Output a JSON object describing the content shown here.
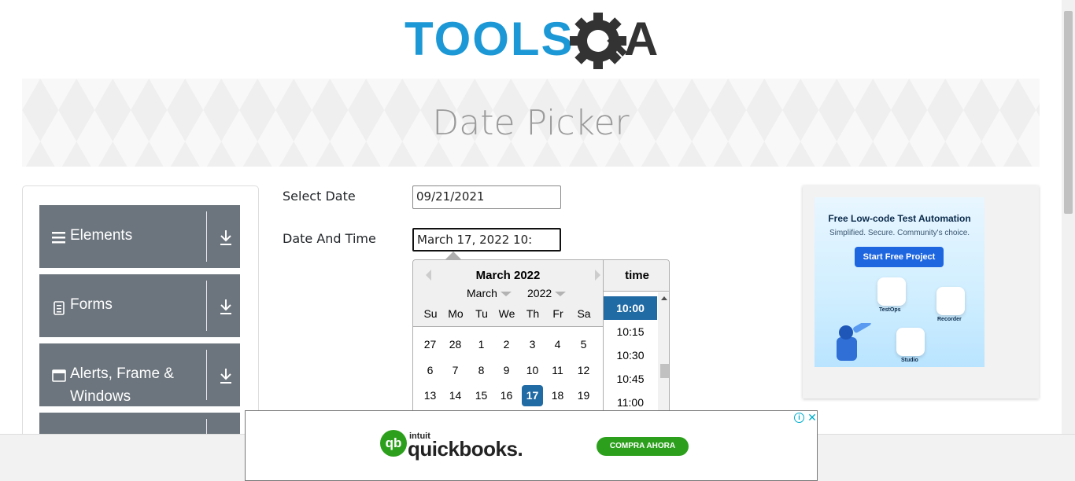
{
  "header": {
    "logo_text_left": "TOOLS",
    "logo_text_right": "A",
    "page_title": "Date Picker"
  },
  "sidebar": {
    "groups": [
      {
        "label": "Elements",
        "icon": "hamburger-icon"
      },
      {
        "label": "Forms",
        "icon": "document-icon"
      },
      {
        "label": "Alerts, Frame & Windows",
        "icon": "window-icon"
      }
    ],
    "group_toggle_icon": "download-arrow-icon"
  },
  "form": {
    "select_date_label": "Select Date",
    "select_date_value": "09/21/2021",
    "date_time_label": "Date And Time",
    "date_time_value": "March 17, 2022 10:"
  },
  "datepicker": {
    "month_title": "March 2022",
    "month_select": "March",
    "year_select": "2022",
    "weekdays": [
      "Su",
      "Mo",
      "Tu",
      "We",
      "Th",
      "Fr",
      "Sa"
    ],
    "weeks": [
      [
        "27",
        "28",
        "1",
        "2",
        "3",
        "4",
        "5"
      ],
      [
        "6",
        "7",
        "8",
        "9",
        "10",
        "11",
        "12"
      ],
      [
        "13",
        "14",
        "15",
        "16",
        "17",
        "18",
        "19"
      ]
    ],
    "selected_day": "17",
    "time_header": "time",
    "times": [
      "10:00",
      "10:15",
      "10:30",
      "10:45",
      "11:00"
    ],
    "selected_time": "10:00"
  },
  "ad_right": {
    "title": "Free Low-code Test Automation",
    "subtitle": "Simplified. Secure. Community's choice.",
    "button": "Start Free Project",
    "products": [
      "TestOps",
      "Recorder",
      "Studio"
    ]
  },
  "ad_bottom": {
    "brand_small": "intuit",
    "brand": "quickbooks.",
    "logo_glyph": "qb",
    "cta": "COMPRA AHORA",
    "info_glyph": "i",
    "close_glyph": "✕"
  },
  "colors": {
    "logo_blue": "#1b98d5",
    "logo_dark": "#333333",
    "sidebar_group": "#6c757d",
    "picker_accent": "#216ba5",
    "qb_green": "#2ca01c"
  }
}
